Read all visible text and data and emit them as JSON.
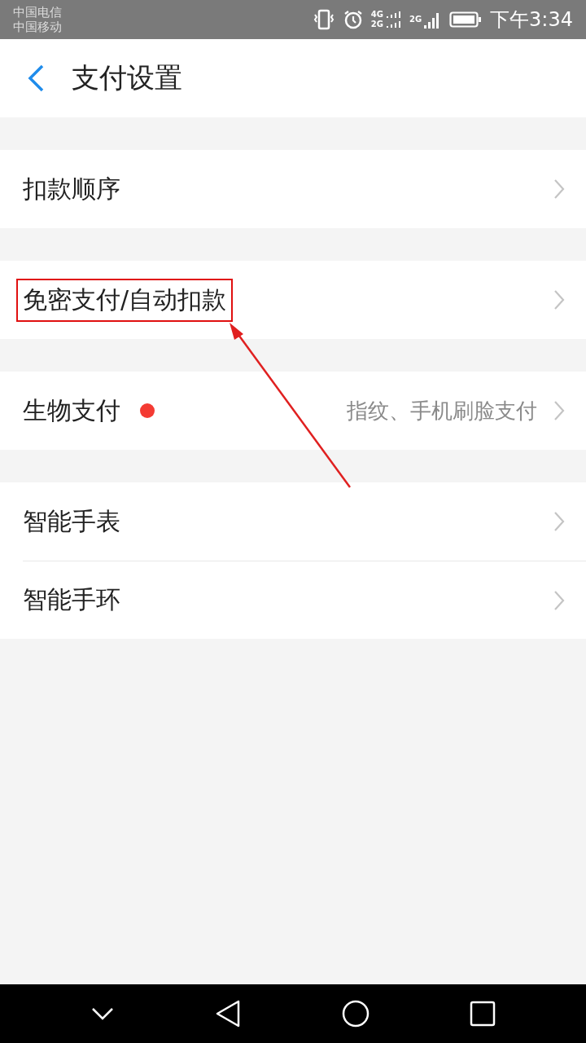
{
  "status_bar": {
    "carriers": [
      "中国电信",
      "中国移动"
    ],
    "network_labels": [
      "4G",
      "2G",
      "2G"
    ],
    "time": "下午3:34"
  },
  "header": {
    "title": "支付设置"
  },
  "groups": [
    {
      "items": [
        {
          "label": "扣款顺序",
          "highlighted": false,
          "badge": false
        }
      ]
    },
    {
      "items": [
        {
          "label": "免密支付/自动扣款",
          "highlighted": true,
          "badge": false
        }
      ]
    },
    {
      "items": [
        {
          "label": "生物支付",
          "highlighted": false,
          "badge": true,
          "value": "指纹、手机刷脸支付"
        }
      ]
    },
    {
      "items": [
        {
          "label": "智能手表",
          "highlighted": false,
          "badge": false
        },
        {
          "label": "智能手环",
          "highlighted": false,
          "badge": false
        }
      ]
    }
  ]
}
